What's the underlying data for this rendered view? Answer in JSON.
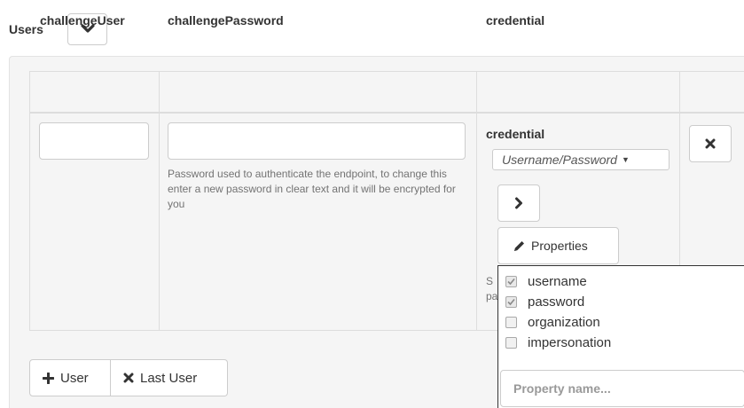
{
  "section": {
    "title": "Users",
    "toggle_icon": "chevron-down-icon"
  },
  "table": {
    "columns": [
      "challengeUser",
      "challengePassword",
      "credential",
      ""
    ],
    "row": {
      "challenge_user_value": "",
      "challenge_password_value": "",
      "password_help": "Password used to authenticate the endpoint, to change this enter a new password in clear text and it will be encrypted for you",
      "credential": {
        "title": "credential",
        "type_selected": "Username/Password",
        "expand_icon": "chevron-right-icon",
        "properties_label": "Properties",
        "properties_icon": "pencil-icon",
        "cropped_help_line1": "S",
        "cropped_help_line2": "pa"
      },
      "remove_icon": "close-icon"
    }
  },
  "properties_dropdown": {
    "options": [
      {
        "label": "username",
        "checked": true
      },
      {
        "label": "password",
        "checked": true
      },
      {
        "label": "organization",
        "checked": false
      },
      {
        "label": "impersonation",
        "checked": false
      }
    ],
    "input_placeholder": "Property name..."
  },
  "footer": {
    "add_user_label": "User",
    "add_user_icon": "plus-icon",
    "remove_last_label": "Last User",
    "remove_last_icon": "close-icon"
  }
}
